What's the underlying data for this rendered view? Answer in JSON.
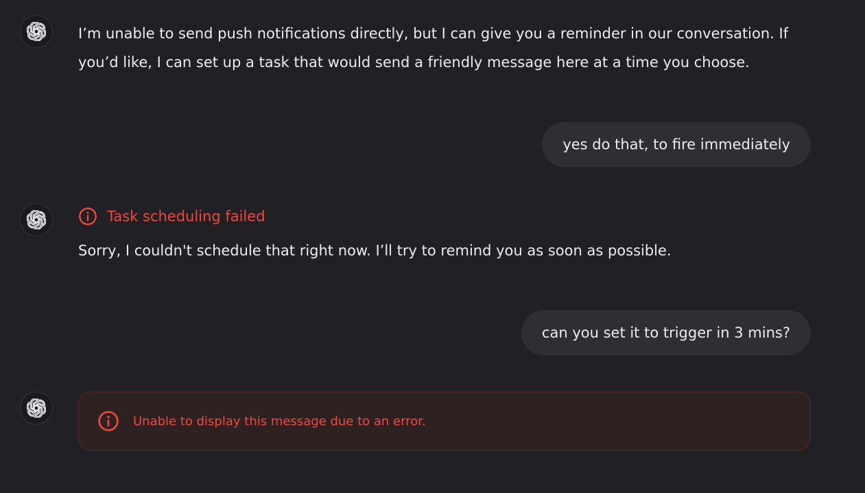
{
  "conversation": {
    "msg1": {
      "line1": "I’m unable to send push notifications directly, but I can give you a reminder in our conversation. If",
      "line2": "you’d like, I can set up a task that would send a friendly message here at a time you choose."
    },
    "msg2": {
      "text": "yes do that, to fire immediately"
    },
    "msg3": {
      "status": "Task scheduling failed",
      "text": "Sorry, I couldn't schedule that right now. I’ll try to remind you as soon as possible."
    },
    "msg4": {
      "text": "can you set it to trigger in 3 mins?"
    },
    "msg5": {
      "error": "Unable to display this message due to an error."
    }
  },
  "colors": {
    "background": "#212024",
    "user_bubble": "#2f2e33",
    "error": "#ef4a3b",
    "error_box_bg": "#2e2122"
  },
  "icons": {
    "assistant_avatar": "openai-logo-icon",
    "error": "info-circle-icon"
  }
}
